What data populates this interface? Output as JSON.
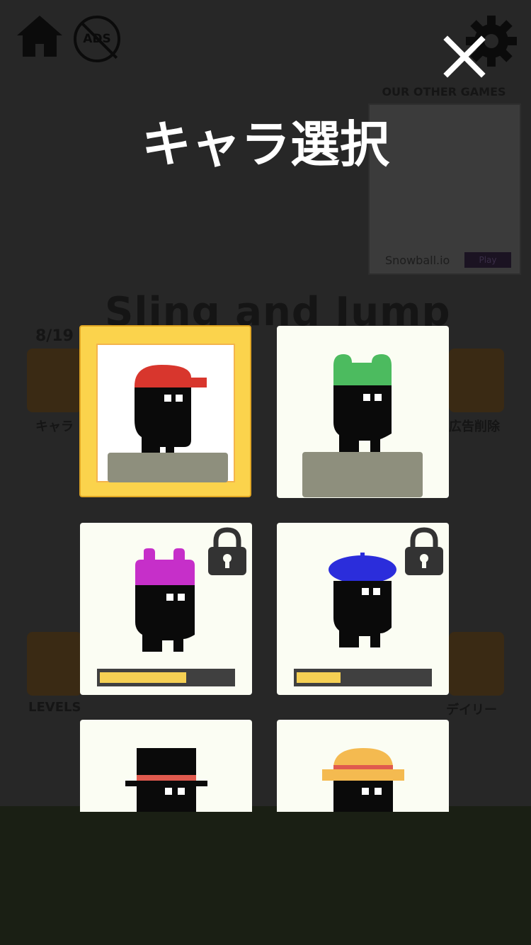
{
  "background": {
    "other_games_label": "OUR OTHER GAMES",
    "ad_game_title": "Snowball.io",
    "ad_play_label": "Play",
    "game_title": "Sling and Jump",
    "level_progress": "8/19",
    "buttons": {
      "chara": "キャラ",
      "remove_ads": "広告削除",
      "levels": "LEVELS",
      "daily": "デイリー"
    },
    "ads_badge": "ADS"
  },
  "dialog": {
    "title": "キャラ選択"
  },
  "characters": [
    {
      "hat": "red-cap",
      "color": "#d8362d",
      "selected": true,
      "locked": false
    },
    {
      "hat": "frog-hat",
      "color": "#4cbb5f",
      "selected": false,
      "locked": false
    },
    {
      "hat": "bunny-ears",
      "color": "#c62fc9",
      "selected": false,
      "locked": true,
      "progress": 0.65
    },
    {
      "hat": "beret",
      "color": "#2b2ddb",
      "selected": false,
      "locked": true,
      "progress": 0.33
    },
    {
      "hat": "top-hat",
      "color": "#0a0a0a",
      "band": "#e05a4e",
      "selected": false,
      "locked": false
    },
    {
      "hat": "straw-hat",
      "color": "#f4ba50",
      "band": "#e05a4e",
      "selected": false,
      "locked": false
    }
  ],
  "colors": {
    "accent": "#fbd34c",
    "card": "#fbfdf3",
    "overlay": "#272727",
    "progress_fill": "#f5d053",
    "progress_track": "#404040"
  }
}
